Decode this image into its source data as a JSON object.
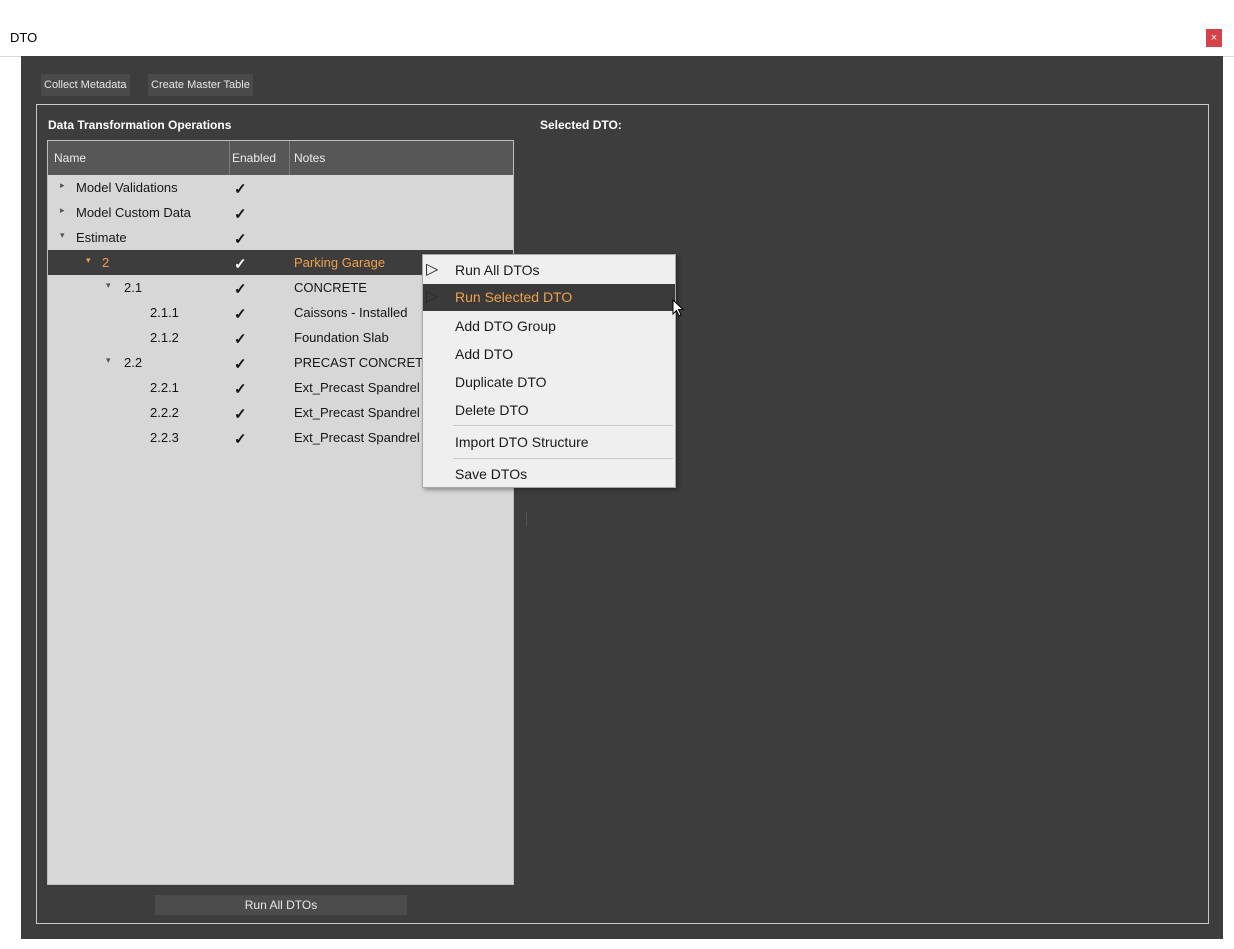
{
  "window": {
    "title": "DTO",
    "close_glyph": "×"
  },
  "toolbar": {
    "collect_label": "Collect Metadata",
    "master_label": "Create Master Table"
  },
  "left_panel": {
    "title": "Data Transformation Operations",
    "columns": {
      "name": "Name",
      "enabled": "Enabled",
      "notes": "Notes"
    },
    "rows": [
      {
        "name": "Model Validations",
        "enabled": "✓",
        "notes": "",
        "arrow": "▸"
      },
      {
        "name": "Model Custom Data",
        "enabled": "✓",
        "notes": "",
        "arrow": "▸"
      },
      {
        "name": "Estimate",
        "enabled": "✓",
        "notes": "",
        "arrow": "▾"
      },
      {
        "name": "2",
        "enabled": "✓",
        "notes": "Parking Garage",
        "arrow": "▾"
      },
      {
        "name": "2.1",
        "enabled": "✓",
        "notes": "CONCRETE",
        "arrow": "▾"
      },
      {
        "name": "2.1.1",
        "enabled": "✓",
        "notes": "Caissons - Installed",
        "arrow": ""
      },
      {
        "name": "2.1.2",
        "enabled": "✓",
        "notes": "Foundation Slab",
        "arrow": ""
      },
      {
        "name": "2.2",
        "enabled": "✓",
        "notes": "PRECAST CONCRETE",
        "arrow": "▾"
      },
      {
        "name": "2.2.1",
        "enabled": "✓",
        "notes": "Ext_Precast Spandrel",
        "arrow": ""
      },
      {
        "name": "2.2.2",
        "enabled": "✓",
        "notes": "Ext_Precast Spandrel",
        "arrow": ""
      },
      {
        "name": "2.2.3",
        "enabled": "✓",
        "notes": "Ext_Precast Spandrel",
        "arrow": ""
      }
    ],
    "run_all_label": "Run All DTOs"
  },
  "right_panel": {
    "title": "Selected DTO:"
  },
  "context_menu": {
    "items": [
      {
        "label": "Run All DTOs",
        "icon": "▷"
      },
      {
        "label": "Run Selected DTO",
        "icon": "▷"
      },
      {
        "label": "Add DTO Group",
        "icon": ""
      },
      {
        "label": "Add DTO",
        "icon": ""
      },
      {
        "label": "Duplicate DTO",
        "icon": ""
      },
      {
        "label": "Delete DTO",
        "icon": ""
      },
      {
        "label": "Import DTO Structure",
        "icon": ""
      },
      {
        "label": "Save DTOs",
        "icon": ""
      }
    ]
  },
  "colors": {
    "accent": "#f0a04b",
    "background": "#3d3d3d",
    "tree_bg": "#d7d7d7",
    "close": "#d6424a"
  }
}
